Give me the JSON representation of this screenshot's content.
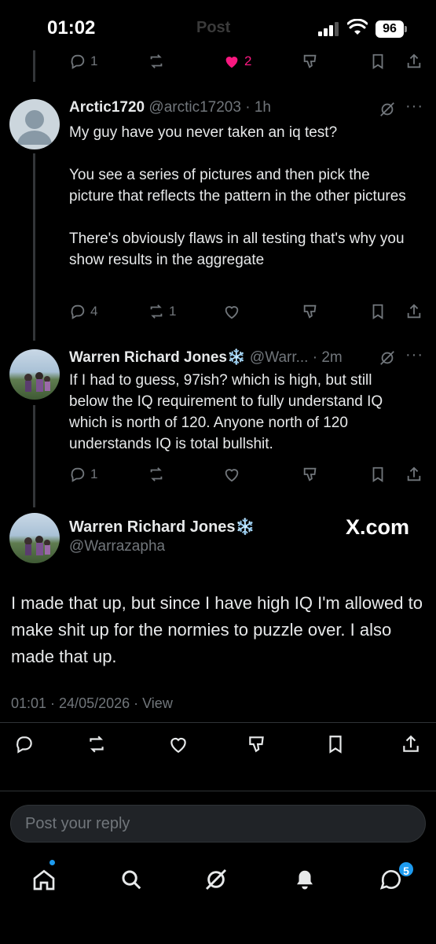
{
  "status_bar": {
    "time": "01:02",
    "header_ghost": "Post",
    "battery": "96"
  },
  "top_post_actions": {
    "replies": "1",
    "reposts": "",
    "likes": "2",
    "liked": true
  },
  "replies": [
    {
      "name": "Arctic1720",
      "handle": "@arctic17203",
      "time": "1h",
      "paragraphs": [
        "My guy have you never taken an iq test?",
        "You see a series of pictures and then pick the picture that reflects the pattern in the other pictures",
        "There's obviously flaws in all testing that's why you show results in the aggregate"
      ],
      "actions": {
        "replies": "4",
        "reposts": "1",
        "likes": ""
      }
    },
    {
      "name": "Warren Richard Jones",
      "name_emoji": "❄️",
      "handle": "@Warr...",
      "time": "2m",
      "paragraphs": [
        "If I had to guess, 97ish? which is high, but still below the IQ requirement to fully understand IQ which is north of 120. Anyone north of 120 understands IQ is total bullshit."
      ],
      "actions": {
        "replies": "1",
        "reposts": "",
        "likes": ""
      }
    }
  ],
  "main_post": {
    "name": "Warren Richard Jones",
    "name_emoji": "❄️",
    "handle": "@Warrazapha",
    "watermark": "X.com",
    "text": "I made that up, but since I have high IQ I'm allowed to make shit up for the normies to puzzle over. I also made that up.",
    "meta": "01:01 · 24/05/2026 · View"
  },
  "reply_box": {
    "placeholder": "Post your reply"
  },
  "nav": {
    "messages_badge": "5"
  },
  "colors": {
    "background": "#000000",
    "text": "#e7e9ea",
    "muted": "#71767b",
    "like": "#f91880",
    "accent": "#1d9bf0"
  },
  "icons": [
    "reply-icon",
    "repost-icon",
    "like-icon",
    "grok-icon",
    "bookmark-icon",
    "share-icon",
    "more-icon",
    "home-icon",
    "search-icon",
    "notifications-icon",
    "messages-icon"
  ]
}
